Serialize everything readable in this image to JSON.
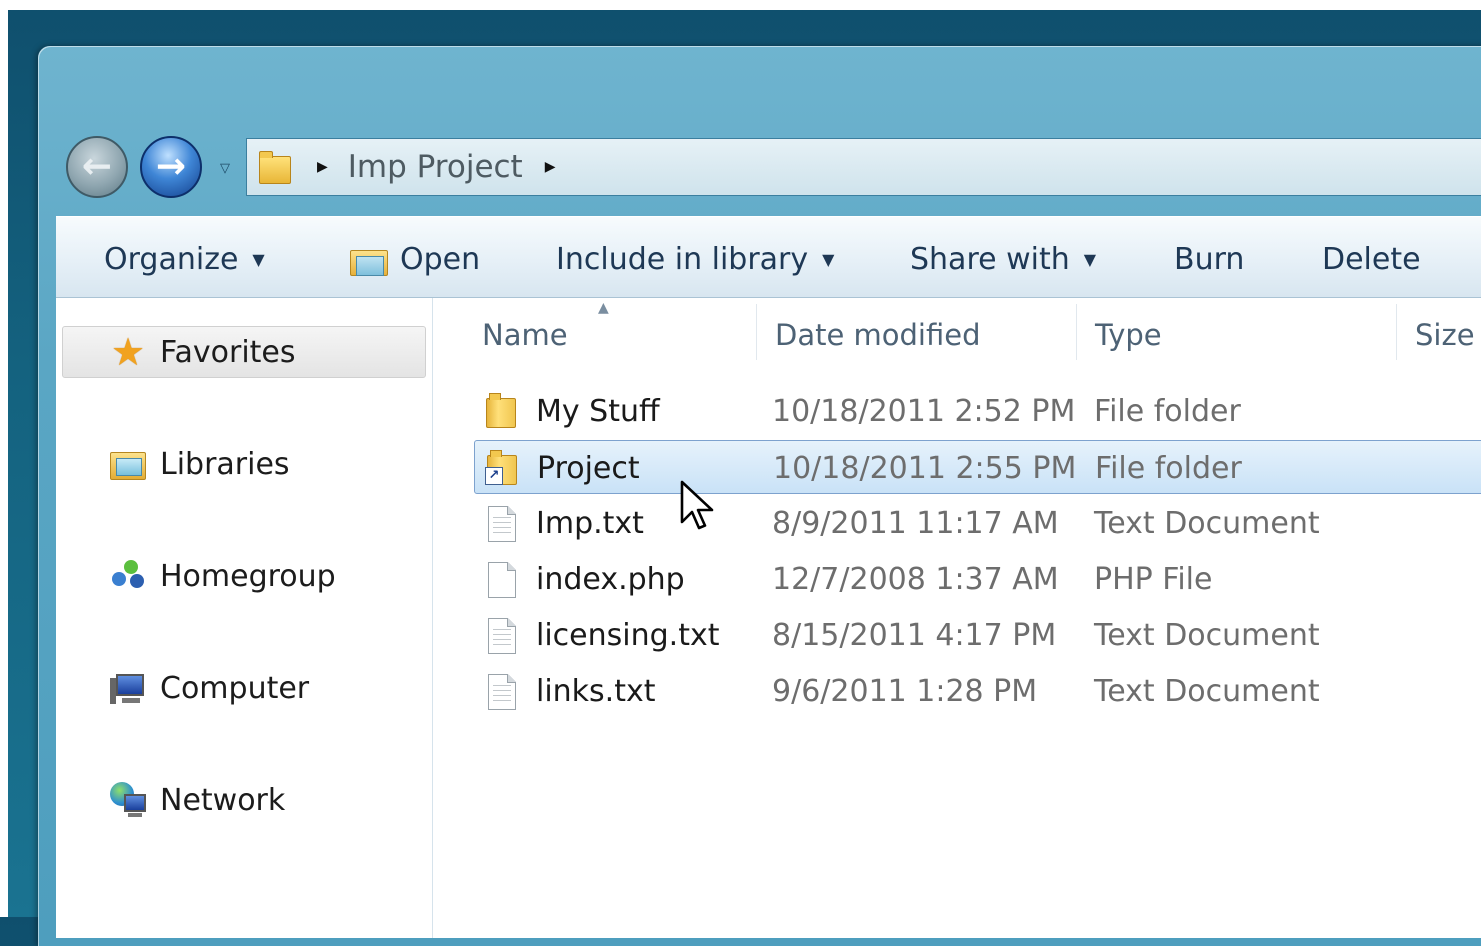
{
  "address": {
    "path": "Imp Project"
  },
  "toolbar": {
    "organize": "Organize",
    "open": "Open",
    "include_in_library": "Include in library",
    "share_with": "Share with",
    "burn": "Burn",
    "delete": "Delete"
  },
  "navpane": {
    "items": [
      {
        "label": "Favorites",
        "icon": "star-icon"
      },
      {
        "label": "Libraries",
        "icon": "libraries-icon"
      },
      {
        "label": "Homegroup",
        "icon": "homegroup-icon"
      },
      {
        "label": "Computer",
        "icon": "computer-icon"
      },
      {
        "label": "Network",
        "icon": "network-icon"
      }
    ]
  },
  "filelist": {
    "columns": [
      "Name",
      "Date modified",
      "Type",
      "Size"
    ],
    "rows": [
      {
        "name": "My Stuff",
        "date": "10/18/2011 2:52 PM",
        "type": "File folder",
        "icon": "folder-icon"
      },
      {
        "name": "Project",
        "date": "10/18/2011 2:55 PM",
        "type": "File folder",
        "icon": "folder-shortcut-icon",
        "selected": true
      },
      {
        "name": "Imp.txt",
        "date": "8/9/2011 11:17 AM",
        "type": "Text Document",
        "icon": "text-file-icon"
      },
      {
        "name": "index.php",
        "date": "12/7/2008 1:37 AM",
        "type": "PHP File",
        "icon": "file-icon"
      },
      {
        "name": "licensing.txt",
        "date": "8/15/2011 4:17 PM",
        "type": "Text Document",
        "icon": "text-file-icon"
      },
      {
        "name": "links.txt",
        "date": "9/6/2011 1:28 PM",
        "type": "Text Document",
        "icon": "text-file-icon"
      }
    ]
  },
  "colors": {
    "selection_bg": "#c9e2f7",
    "selection_border": "#7da2ce",
    "command_text": "#1e3855"
  }
}
